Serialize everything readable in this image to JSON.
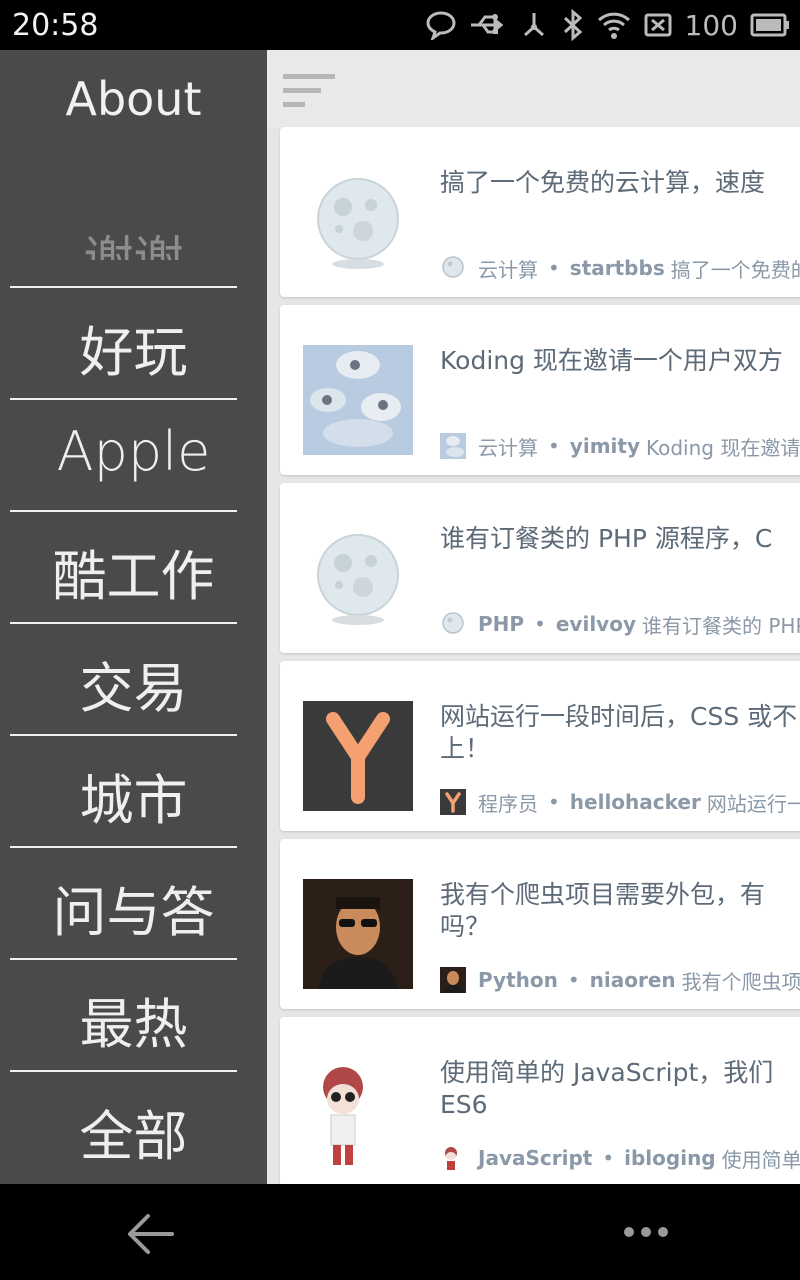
{
  "status_bar": {
    "time": "20:58",
    "battery": "100",
    "icons": [
      "chat-bubble-icon",
      "usb-icon",
      "usb-debug-icon",
      "bluetooth-icon",
      "wifi-icon",
      "no-sim-icon",
      "battery-icon"
    ]
  },
  "drawer": {
    "title": "About",
    "partial_item": "谢谢",
    "items": [
      {
        "label": "好玩"
      },
      {
        "label": "Apple"
      },
      {
        "label": "酷工作"
      },
      {
        "label": "交易"
      },
      {
        "label": "城市"
      },
      {
        "label": "问与答"
      },
      {
        "label": "最热"
      },
      {
        "label": "全部"
      }
    ]
  },
  "topbar": {
    "menu_icon": "sort-menu-icon"
  },
  "feed": [
    {
      "title": "搞了一个免费的云计算，速度",
      "node": "云计算",
      "author": "startbbs",
      "excerpt": "搞了一个免费的",
      "avatar": "moon-avatar"
    },
    {
      "title": "Koding 现在邀请一个用户双方",
      "node": "云计算",
      "author": "yimity",
      "excerpt": "Koding 现在邀请",
      "avatar": "clouds-avatar"
    },
    {
      "title": "谁有订餐类的 PHP 源程序，C",
      "node": "PHP",
      "author": "evilvoy",
      "excerpt": "谁有订餐类的 PHP",
      "avatar": "moon-avatar"
    },
    {
      "title": "网站运行一段时间后，CSS 或不上！",
      "node": "程序员",
      "author": "hellohacker",
      "excerpt": "网站运行一",
      "avatar": "y-avatar"
    },
    {
      "title": "我有个爬虫项目需要外包，有吗？",
      "node": "Python",
      "author": "niaoren",
      "excerpt": "我有个爬虫项目",
      "avatar": "man-avatar"
    },
    {
      "title": "使用简单的 JavaScript，我们 ES6",
      "node": "JavaScript",
      "author": "ibloging",
      "excerpt": "使用简单的",
      "avatar": "cartoon-avatar"
    }
  ],
  "colors": {
    "drawer_bg": "#4a4a4a",
    "content_bg": "#e6e6e6",
    "card_bg": "#ffffff",
    "title_text": "#5d6a78",
    "meta_text": "#8a98a8"
  }
}
